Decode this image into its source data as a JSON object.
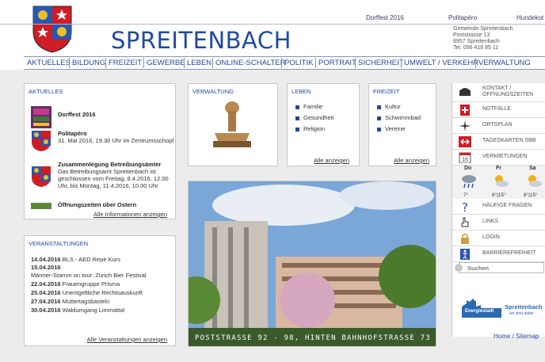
{
  "header": {
    "site_title": "SPREITENBACH",
    "toplinks": [
      "Dorffest 2016",
      "Politapéro",
      "Hundekot"
    ],
    "address": [
      "Gemeinde Spreitenbach",
      "Poststrasse 13",
      "8957 Spreitenbach",
      "Tel. 056 418 85 11"
    ]
  },
  "nav": [
    "AKTUELLES",
    "BILDUNG",
    "FREIZEIT",
    "GEWERBE",
    "LEBEN",
    "ONLINE-SCHALTER",
    "POLITIK",
    "PORTRAIT",
    "SICHERHEIT",
    "UMWELT / VERKEHR",
    "VERWALTUNG"
  ],
  "aktuelles": {
    "title": "AKTUELLES",
    "items": [
      {
        "title": "Dorffest 2016",
        "text": ""
      },
      {
        "title": "Politapéro",
        "text": "31. Mai 2016, 19.30 Uhr im Zentrumsschopf"
      },
      {
        "title": "Zusammenlegung Betreibungsämter",
        "text": "Das Betreibungsamt Spreitenbach ist geschlossen vom Freitag, 8.4.2016, 12.00 Uhr, bis Montag, 11.4.2016, 10.00 Uhr"
      },
      {
        "title": "Öffnungszeiten über Ostern",
        "text": ""
      }
    ],
    "more": "Alle Informationen anzeigen"
  },
  "veranstaltungen": {
    "title": "VERANSTALTUNGEN",
    "items": [
      {
        "date": "14.04.2016",
        "text": "BLS - AED Repe Kurs"
      },
      {
        "date": "15.04.2016",
        "text": "Männer-Stamm on tour: Zürich Bier Festival"
      },
      {
        "date": "22.04.2016",
        "text": "Frauengruppe Prisma"
      },
      {
        "date": "25.04.2016",
        "text": "Unentgeltliche Rechtsauskunft"
      },
      {
        "date": "27.04.2016",
        "text": "Muttertagsbasteln"
      },
      {
        "date": "30.04.2016",
        "text": "Waldumgang Limmattal"
      }
    ],
    "more": "Alle Veranstaltungen anzeigen"
  },
  "verwaltung": {
    "title": "VERWALTUNG"
  },
  "leben": {
    "title": "LEBEN",
    "items": [
      "Familie",
      "Gesundheit",
      "Religion"
    ],
    "more": "Alle anzeigen"
  },
  "freizeit": {
    "title": "FREIZEIT",
    "items": [
      "Kultur",
      "Schwimmbad",
      "Vereine"
    ],
    "more": "Alle anzeigen"
  },
  "photo": {
    "caption": "POSTSTRASSE 92 - 98, HINTEN BAHNHOFSTRASSE 73"
  },
  "sidebar": {
    "items": [
      {
        "icon": "phone-icon",
        "label": "KONTAKT / ÖFFNUNGSZEITEN"
      },
      {
        "icon": "first-aid-icon",
        "label": "NOTFÄLLE"
      },
      {
        "icon": "compass-icon",
        "label": "ORTSPLAN"
      },
      {
        "icon": "sbb-icon",
        "label": "TAGESKARTEN SBB"
      },
      {
        "icon": "calendar-icon",
        "label": "VERMIETUNGEN"
      }
    ],
    "weather": {
      "days": [
        "Do",
        "Fr",
        "Sa"
      ],
      "temps": [
        "7°",
        "6°|15°",
        "8°|15°"
      ]
    },
    "items2": [
      {
        "icon": "question-icon",
        "label": "HÄUFIGE FRAGEN"
      },
      {
        "icon": "hand-pointer-icon",
        "label": "LINKS"
      },
      {
        "icon": "lock-icon",
        "label": "LOGIN"
      },
      {
        "icon": "accessibility-icon",
        "label": "BARRIEREFREIHEIT"
      }
    ],
    "search_placeholder": "Suchen",
    "energiestadt": {
      "brand": "Energiestadt",
      "name": "Spreitenbach",
      "slogan": "wir sind dabei"
    },
    "footer_link": "Home / Sitemap"
  },
  "colors": {
    "brand_blue": "#1f4aa0",
    "crest_red": "#d01c24",
    "crest_gold": "#e8c02a"
  }
}
